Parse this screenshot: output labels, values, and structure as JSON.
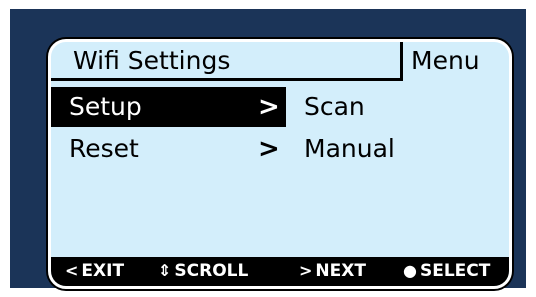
{
  "header": {
    "title": "Wifi Settings",
    "menu_label": "Menu"
  },
  "menu": {
    "items": [
      {
        "label": "Setup",
        "selected": true
      },
      {
        "label": "Reset",
        "selected": false
      }
    ]
  },
  "submenu": {
    "items": [
      {
        "label": "Scan"
      },
      {
        "label": "Manual"
      }
    ]
  },
  "footer": {
    "exit": "EXIT",
    "scroll": "SCROLL",
    "next": "NEXT",
    "select": "SELECT"
  },
  "icons": {
    "exit": "chevron-left",
    "scroll": "up-down-arrow",
    "next": "chevron-right",
    "select": "dot",
    "item_arrow": "chevron-right"
  },
  "colors": {
    "bezel": "#1b3458",
    "screen": "#d3eefb",
    "selection": "#000000"
  }
}
